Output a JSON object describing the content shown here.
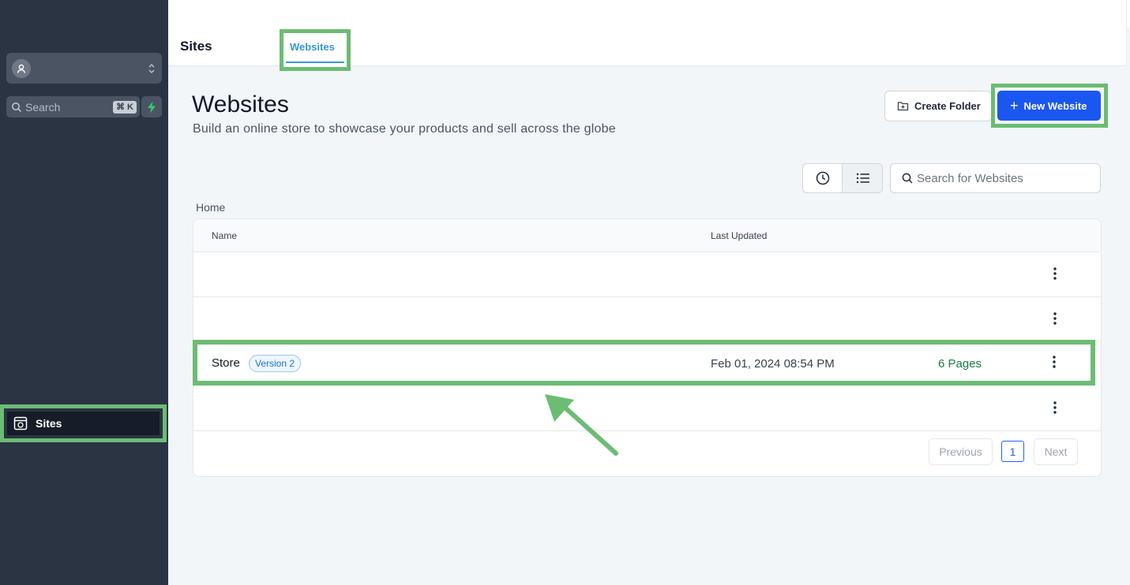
{
  "sidebar": {
    "search_placeholder": "Search",
    "search_shortcut": "⌘ K",
    "nav_sites_label": "Sites"
  },
  "header": {
    "section_title": "Sites",
    "active_tab": "Websites"
  },
  "main": {
    "title": "Websites",
    "subtitle": "Build an online store to showcase your products and sell across the globe",
    "create_folder_label": "Create Folder",
    "new_website_label": "New Website",
    "search_placeholder": "Search for Websites",
    "breadcrumb": "Home"
  },
  "table": {
    "columns": [
      "Name",
      "Last Updated"
    ],
    "rows": [
      {
        "name": "",
        "version": "",
        "updated": "",
        "pages": ""
      },
      {
        "name": "",
        "version": "",
        "updated": "",
        "pages": ""
      },
      {
        "name": "Store",
        "version": "Version 2",
        "updated": "Feb 01, 2024 08:54 PM",
        "pages": "6 Pages"
      },
      {
        "name": "",
        "version": "",
        "updated": "",
        "pages": ""
      }
    ]
  },
  "pagination": {
    "previous_label": "Previous",
    "current_page": "1",
    "next_label": "Next"
  },
  "colors": {
    "primary": "#1a56f0",
    "highlight": "#6cbc74",
    "sidebar_bg": "#2b3443",
    "tab_accent": "#3598d8",
    "pages_text": "#15803d"
  },
  "icons": [
    "user-icon",
    "chevron-updown-icon",
    "search-icon",
    "bolt-icon",
    "sites-icon",
    "folder-plus-icon",
    "plus-icon",
    "clock-icon",
    "list-icon",
    "kebab-menu-icon",
    "arrow-icon"
  ]
}
